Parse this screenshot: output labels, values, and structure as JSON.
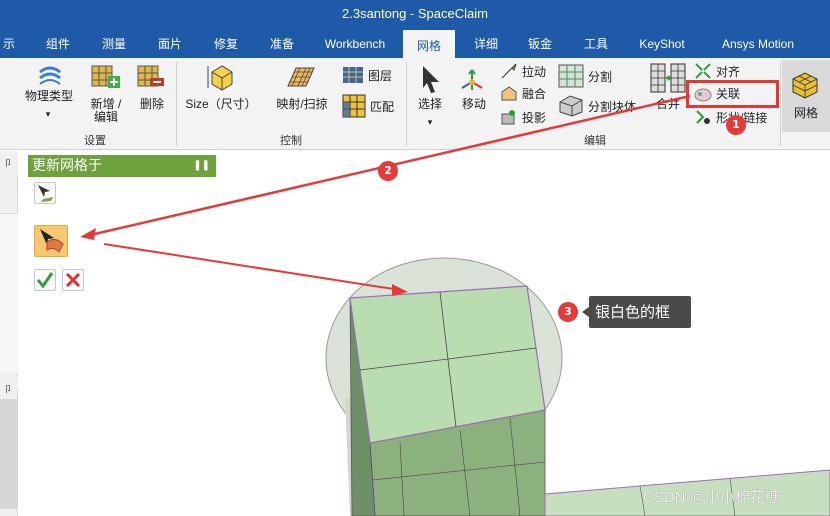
{
  "window": {
    "title": "2.3santong - SpaceClaim"
  },
  "tabs": [
    {
      "label": "示"
    },
    {
      "label": "组件"
    },
    {
      "label": "测量"
    },
    {
      "label": "面片"
    },
    {
      "label": "修复"
    },
    {
      "label": "准备"
    },
    {
      "label": "Workbench"
    },
    {
      "label": "网格"
    },
    {
      "label": "详细"
    },
    {
      "label": "钣金"
    },
    {
      "label": "工具"
    },
    {
      "label": "KeyShot"
    },
    {
      "label": "Ansys Motion"
    }
  ],
  "ribbon": {
    "physics_type": "物理类型",
    "add_edit": "新增 / 编辑",
    "delete": "删除",
    "group_settings": "设置",
    "size": "Size（尺寸）",
    "map_sweep": "映射/扫掠",
    "layer": "图层",
    "match": "匹配",
    "group_control": "控制",
    "select": "选择",
    "move": "移动",
    "pull": "拉动",
    "blend": "融合",
    "project": "投影",
    "split": "分割",
    "split_block": "分割块体",
    "merge": "合并",
    "align": "对齐",
    "associate": "关联",
    "shape_link": "形状/链接",
    "group_edit": "编辑",
    "mesh": "网格"
  },
  "panel": {
    "title": "更新网格于"
  },
  "annotations": {
    "badge1": "1",
    "badge2": "2",
    "badge3": "3",
    "callout3": "银白色的框"
  },
  "watermark": "CSDN @小小棉花糖",
  "colors": {
    "accent": "#1e5aa8",
    "panel_header": "#6ea23d",
    "highlight": "#e63737",
    "mesh_face": "#b9ddb0"
  }
}
